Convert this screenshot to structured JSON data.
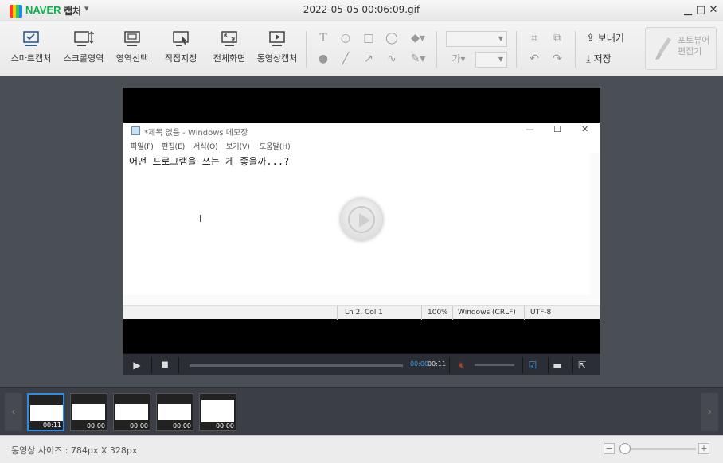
{
  "app": {
    "brand": "NAVER",
    "brand_sub": "캡처",
    "window_title": "2022-05-05 00:06:09.gif"
  },
  "toolbar": {
    "tools": [
      {
        "label": "스마트캡처",
        "icon": "smart-capture-icon"
      },
      {
        "label": "스크롤영역",
        "icon": "scroll-area-icon"
      },
      {
        "label": "영역선택",
        "icon": "region-select-icon"
      },
      {
        "label": "직접지정",
        "icon": "manual-select-icon"
      },
      {
        "label": "전체화면",
        "icon": "fullscreen-icon"
      },
      {
        "label": "동영상캡처",
        "icon": "video-capture-icon"
      }
    ],
    "send_label": "보내기",
    "save_label": "저장",
    "editor_label": "포토뷰어\n편집기",
    "text_tool_label": "가"
  },
  "notepad": {
    "title": "*제목 없음 - Windows 메모장",
    "menus": [
      "파일(F)",
      "편집(E)",
      "서식(O)",
      "보기(V)",
      "도움말(H)"
    ],
    "content": "어떤 프로그램을 쓰는 게 좋을까...?",
    "status": {
      "position": "Ln 2, Col 1",
      "zoom": "100%",
      "line_ending": "Windows (CRLF)",
      "encoding": "UTF-8"
    }
  },
  "player": {
    "current_time": "00:00",
    "total_time": "00:11"
  },
  "thumbnails": [
    {
      "label": "00:11",
      "selected": true
    },
    {
      "label": "00:00",
      "selected": false
    },
    {
      "label": "00:00",
      "selected": false
    },
    {
      "label": "00:00",
      "selected": false
    },
    {
      "label": "00:00",
      "selected": false
    }
  ],
  "statusbar": {
    "text": "동영상 사이즈 : 784px X 328px"
  },
  "colors": {
    "accent": "#2f8ce5",
    "brand": "#0bb04a"
  }
}
